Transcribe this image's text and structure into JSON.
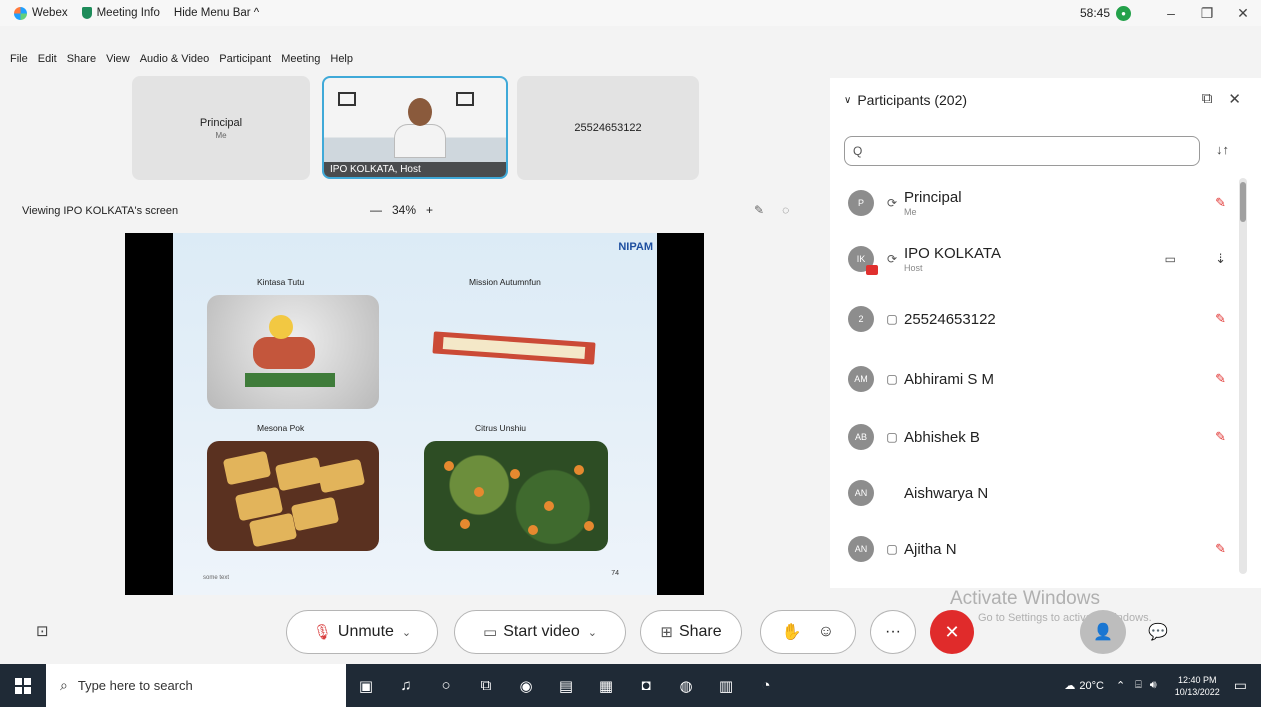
{
  "titlebar": {
    "app_name": "Webex",
    "meeting_info": "Meeting Info",
    "hide_menu": "Hide Menu Bar ^",
    "timer": "58:45",
    "window_controls": [
      "–",
      "❐",
      "✕"
    ]
  },
  "menu": [
    "File",
    "Edit",
    "Share",
    "View",
    "Audio & Video",
    "Participant",
    "Meeting",
    "Help"
  ],
  "videos": {
    "principal": {
      "name": "Principal",
      "role": "Me"
    },
    "host": {
      "label": "IPO KOLKATA, Host"
    },
    "phone": {
      "name": "25524653122"
    }
  },
  "viewing": {
    "label": "Viewing IPO KOLKATA's screen",
    "zoom": "34%",
    "zoom_minus": "—",
    "zoom_plus": "+"
  },
  "slide": {
    "logo": "NIPAM",
    "captions": [
      "Kintasa Tutu",
      "Mission Autumnfun",
      "Mesona Pok",
      "Citrus Unshiu"
    ],
    "footer": "some text",
    "page_number": "74"
  },
  "participants": {
    "title": "Participants (202)",
    "search_placeholder": "Q",
    "list": [
      {
        "initials": "P",
        "name": "Principal",
        "role": "Me",
        "device": "⟳",
        "mic": "✎",
        "cam": ""
      },
      {
        "initials": "IK",
        "name": "IPO KOLKATA",
        "role": "Host",
        "device": "⟳",
        "mic": "⇣",
        "cam": "▭"
      },
      {
        "initials": "2",
        "name": "25524653122",
        "role": "",
        "device": "▢",
        "mic": "✎",
        "cam": ""
      },
      {
        "initials": "AM",
        "name": "Abhirami S M",
        "role": "",
        "device": "▢",
        "mic": "✎",
        "cam": ""
      },
      {
        "initials": "AB",
        "name": "Abhishek B",
        "role": "",
        "device": "▢",
        "mic": "✎",
        "cam": ""
      },
      {
        "initials": "AN",
        "name": "Aishwarya N",
        "role": "",
        "device": "",
        "mic": "",
        "cam": ""
      },
      {
        "initials": "AN",
        "name": "Ajitha N",
        "role": "",
        "device": "▢",
        "mic": "✎",
        "cam": ""
      }
    ]
  },
  "controls": {
    "unmute": "Unmute",
    "start_video": "Start video",
    "share": "Share",
    "more": "···"
  },
  "watermark": {
    "title": "Activate Windows",
    "subtitle": "Go to Settings to activate Windows."
  },
  "taskbar": {
    "search_placeholder": "Type here to search",
    "weather": "20°C",
    "time": "12:40 PM",
    "date": "10/13/2022"
  }
}
